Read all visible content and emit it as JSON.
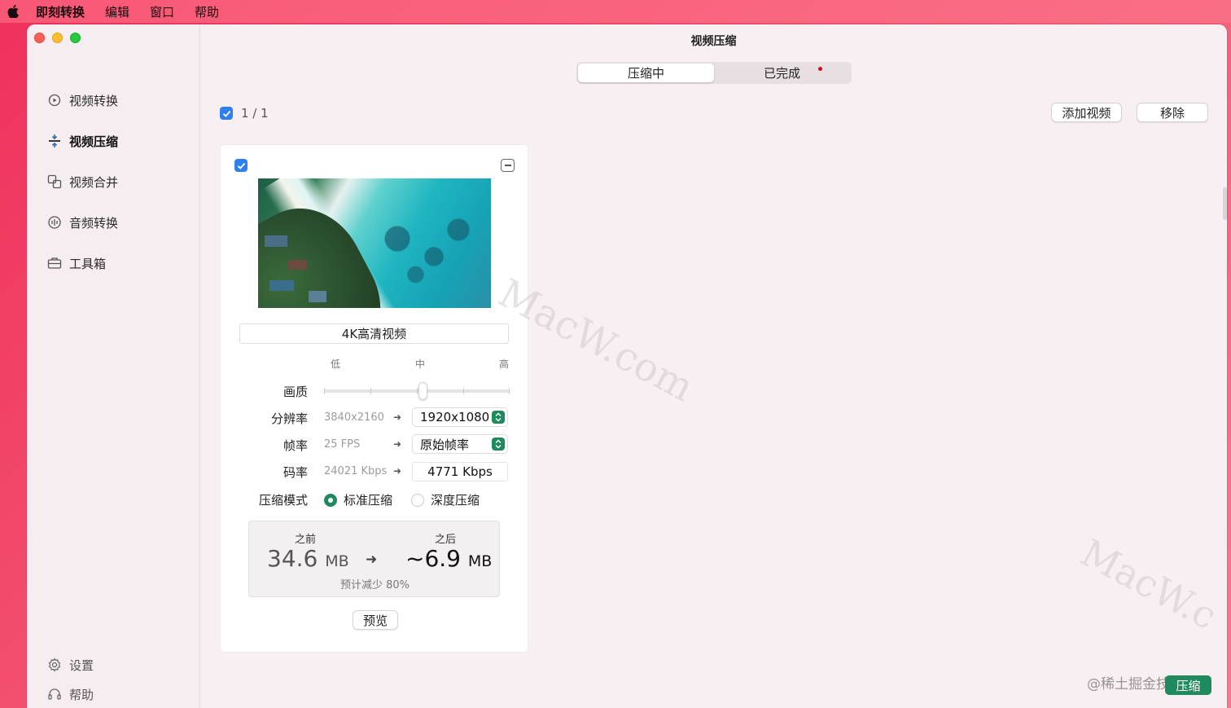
{
  "menubar": {
    "app_name": "即刻转换",
    "items": [
      "编辑",
      "窗口",
      "帮助"
    ]
  },
  "window": {
    "title": "视频压缩"
  },
  "sidebar": {
    "items": [
      {
        "label": "视频转换",
        "icon": "convert-icon"
      },
      {
        "label": "视频压缩",
        "icon": "compress-icon",
        "active": true
      },
      {
        "label": "视频合并",
        "icon": "merge-icon"
      },
      {
        "label": "音频转换",
        "icon": "audio-icon"
      },
      {
        "label": "工具箱",
        "icon": "toolbox-icon"
      }
    ],
    "bottom": [
      {
        "label": "设置",
        "icon": "gear-icon"
      },
      {
        "label": "帮助",
        "icon": "headset-icon"
      }
    ]
  },
  "tabs": [
    {
      "label": "压缩中",
      "selected": true
    },
    {
      "label": "已完成",
      "selected": false
    }
  ],
  "selection": {
    "count": "1 / 1"
  },
  "toolbar": {
    "add_label": "添加视频",
    "remove_label": "移除"
  },
  "card": {
    "video_name": "4K高清视频",
    "levels": {
      "low": "低",
      "mid": "中",
      "high": "高"
    },
    "quality_label": "画质",
    "quality_value": 0.5,
    "resolution": {
      "label": "分辨率",
      "original": "3840x2160",
      "target": "1920x1080"
    },
    "framerate": {
      "label": "帧率",
      "original": "25 FPS",
      "target": "原始帧率"
    },
    "bitrate": {
      "label": "码率",
      "original": "24021 Kbps",
      "target": "4771 Kbps"
    },
    "mode": {
      "label": "压缩模式",
      "standard": "标准压缩",
      "deep": "深度压缩",
      "selected": "standard"
    },
    "size": {
      "before_caption": "之前",
      "before_value": "34.6",
      "before_unit": "MB",
      "after_caption": "之后",
      "after_value": "~6.9",
      "after_unit": "MB",
      "note": "预计减少 80%"
    },
    "preview_label": "预览"
  },
  "footer": {
    "watermark": "@稀土掘金技术社区",
    "compress_label": "压缩"
  },
  "watermark_text": "MacW.com",
  "colors": {
    "accent": "#1f8a5e",
    "checkbox": "#2f7fef",
    "badge": "#e0001c"
  }
}
